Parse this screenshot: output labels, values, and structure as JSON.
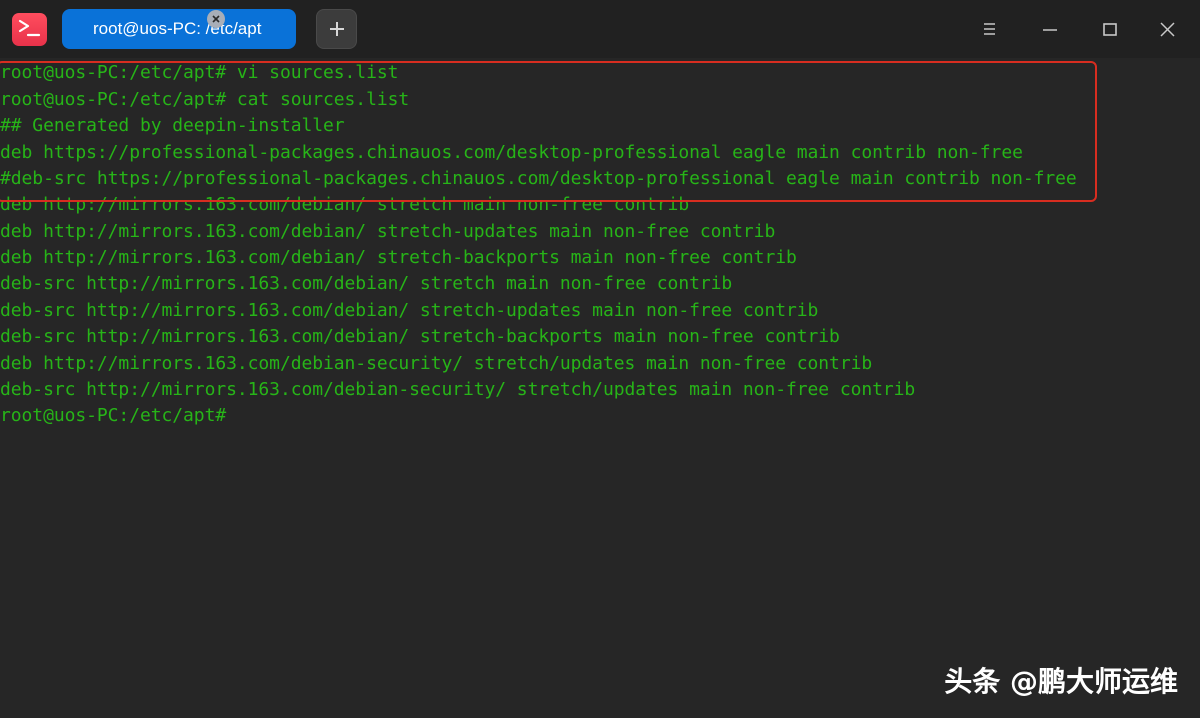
{
  "window": {
    "tab_title": "root@uos-PC: /etc/apt",
    "icons": {
      "app": "terminal-app-icon",
      "tab_close": "close-icon",
      "new_tab": "plus-icon",
      "menu": "hamburger-menu-icon",
      "minimize": "minimize-icon",
      "maximize": "maximize-icon",
      "close": "close-icon"
    },
    "colors": {
      "titlebar_bg": "#212121",
      "tab_bg": "#0a72d8",
      "terminal_bg": "#262626",
      "terminal_text": "#27b418",
      "highlight_border": "#d82d20"
    }
  },
  "terminal": {
    "lines": [
      "root@uos-PC:/etc/apt# vi sources.list",
      "root@uos-PC:/etc/apt# cat sources.list",
      "## Generated by deepin-installer",
      "deb https://professional-packages.chinauos.com/desktop-professional eagle main contrib non-free",
      "#deb-src https://professional-packages.chinauos.com/desktop-professional eagle main contrib non-free",
      "deb http://mirrors.163.com/debian/ stretch main non-free contrib",
      "deb http://mirrors.163.com/debian/ stretch-updates main non-free contrib",
      "deb http://mirrors.163.com/debian/ stretch-backports main non-free contrib",
      "deb-src http://mirrors.163.com/debian/ stretch main non-free contrib",
      "deb-src http://mirrors.163.com/debian/ stretch-updates main non-free contrib",
      "deb-src http://mirrors.163.com/debian/ stretch-backports main non-free contrib",
      "deb http://mirrors.163.com/debian-security/ stretch/updates main non-free contrib",
      "deb-src http://mirrors.163.com/debian-security/ stretch/updates main non-free contrib",
      "root@uos-PC:/etc/apt#"
    ]
  },
  "watermark": "头条 @鹏大师运维"
}
